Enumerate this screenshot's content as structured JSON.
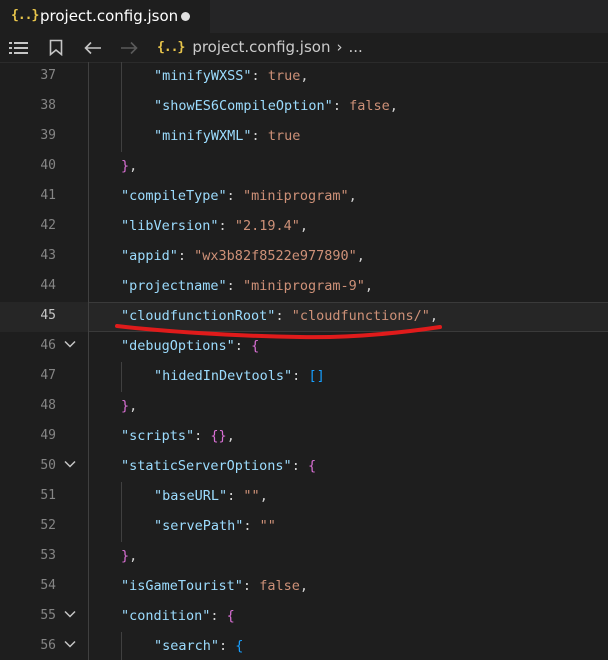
{
  "tab": {
    "title": "project.config.json",
    "icon": "{..}"
  },
  "breadcrumb": {
    "icon": "{..}",
    "file": "project.config.json",
    "more": "..."
  },
  "colors": {
    "annotation": "#e01b1b",
    "background": "#1e1e1e"
  },
  "lines": [
    {
      "num": "37",
      "indent": 2,
      "fold": false,
      "current": false,
      "tokens": [
        {
          "t": "\"minifyWXSS\"",
          "c": "k"
        },
        {
          "t": ": ",
          "c": "p"
        },
        {
          "t": "true",
          "c": "s"
        },
        {
          "t": ",",
          "c": "p"
        }
      ]
    },
    {
      "num": "38",
      "indent": 2,
      "fold": false,
      "current": false,
      "tokens": [
        {
          "t": "\"showES6CompileOption\"",
          "c": "k"
        },
        {
          "t": ": ",
          "c": "p"
        },
        {
          "t": "false",
          "c": "s"
        },
        {
          "t": ",",
          "c": "p"
        }
      ]
    },
    {
      "num": "39",
      "indent": 2,
      "fold": false,
      "current": false,
      "tokens": [
        {
          "t": "\"minifyWXML\"",
          "c": "k"
        },
        {
          "t": ": ",
          "c": "p"
        },
        {
          "t": "true",
          "c": "s"
        }
      ]
    },
    {
      "num": "40",
      "indent": 1,
      "fold": false,
      "current": false,
      "tokens": [
        {
          "t": "}",
          "c": "br2"
        },
        {
          "t": ",",
          "c": "p"
        }
      ]
    },
    {
      "num": "41",
      "indent": 1,
      "fold": false,
      "current": false,
      "tokens": [
        {
          "t": "\"compileType\"",
          "c": "k"
        },
        {
          "t": ": ",
          "c": "p"
        },
        {
          "t": "\"miniprogram\"",
          "c": "s"
        },
        {
          "t": ",",
          "c": "p"
        }
      ]
    },
    {
      "num": "42",
      "indent": 1,
      "fold": false,
      "current": false,
      "tokens": [
        {
          "t": "\"libVersion\"",
          "c": "k"
        },
        {
          "t": ": ",
          "c": "p"
        },
        {
          "t": "\"2.19.4\"",
          "c": "s"
        },
        {
          "t": ",",
          "c": "p"
        }
      ]
    },
    {
      "num": "43",
      "indent": 1,
      "fold": false,
      "current": false,
      "tokens": [
        {
          "t": "\"appid\"",
          "c": "k"
        },
        {
          "t": ": ",
          "c": "p"
        },
        {
          "t": "\"wx3b82f8522e977890\"",
          "c": "s"
        },
        {
          "t": ",",
          "c": "p"
        }
      ]
    },
    {
      "num": "44",
      "indent": 1,
      "fold": false,
      "current": false,
      "tokens": [
        {
          "t": "\"projectname\"",
          "c": "k"
        },
        {
          "t": ": ",
          "c": "p"
        },
        {
          "t": "\"miniprogram-9\"",
          "c": "s"
        },
        {
          "t": ",",
          "c": "p"
        }
      ]
    },
    {
      "num": "45",
      "indent": 1,
      "fold": false,
      "current": true,
      "tokens": [
        {
          "t": "\"cloudfunctionRoot\"",
          "c": "k"
        },
        {
          "t": ": ",
          "c": "p"
        },
        {
          "t": "\"cloudfunctions/\"",
          "c": "s"
        },
        {
          "t": ",",
          "c": "p"
        }
      ]
    },
    {
      "num": "46",
      "indent": 1,
      "fold": true,
      "current": false,
      "tokens": [
        {
          "t": "\"debugOptions\"",
          "c": "k"
        },
        {
          "t": ": ",
          "c": "p"
        },
        {
          "t": "{",
          "c": "br2"
        }
      ]
    },
    {
      "num": "47",
      "indent": 2,
      "fold": false,
      "current": false,
      "tokens": [
        {
          "t": "\"hidedInDevtools\"",
          "c": "k"
        },
        {
          "t": ": ",
          "c": "p"
        },
        {
          "t": "[]",
          "c": "br3"
        }
      ]
    },
    {
      "num": "48",
      "indent": 1,
      "fold": false,
      "current": false,
      "tokens": [
        {
          "t": "}",
          "c": "br2"
        },
        {
          "t": ",",
          "c": "p"
        }
      ]
    },
    {
      "num": "49",
      "indent": 1,
      "fold": false,
      "current": false,
      "tokens": [
        {
          "t": "\"scripts\"",
          "c": "k"
        },
        {
          "t": ": ",
          "c": "p"
        },
        {
          "t": "{}",
          "c": "br2"
        },
        {
          "t": ",",
          "c": "p"
        }
      ]
    },
    {
      "num": "50",
      "indent": 1,
      "fold": true,
      "current": false,
      "tokens": [
        {
          "t": "\"staticServerOptions\"",
          "c": "k"
        },
        {
          "t": ": ",
          "c": "p"
        },
        {
          "t": "{",
          "c": "br2"
        }
      ]
    },
    {
      "num": "51",
      "indent": 2,
      "fold": false,
      "current": false,
      "tokens": [
        {
          "t": "\"baseURL\"",
          "c": "k"
        },
        {
          "t": ": ",
          "c": "p"
        },
        {
          "t": "\"\"",
          "c": "s"
        },
        {
          "t": ",",
          "c": "p"
        }
      ]
    },
    {
      "num": "52",
      "indent": 2,
      "fold": false,
      "current": false,
      "tokens": [
        {
          "t": "\"servePath\"",
          "c": "k"
        },
        {
          "t": ": ",
          "c": "p"
        },
        {
          "t": "\"\"",
          "c": "s"
        }
      ]
    },
    {
      "num": "53",
      "indent": 1,
      "fold": false,
      "current": false,
      "tokens": [
        {
          "t": "}",
          "c": "br2"
        },
        {
          "t": ",",
          "c": "p"
        }
      ]
    },
    {
      "num": "54",
      "indent": 1,
      "fold": false,
      "current": false,
      "tokens": [
        {
          "t": "\"isGameTourist\"",
          "c": "k"
        },
        {
          "t": ": ",
          "c": "p"
        },
        {
          "t": "false",
          "c": "s"
        },
        {
          "t": ",",
          "c": "p"
        }
      ]
    },
    {
      "num": "55",
      "indent": 1,
      "fold": true,
      "current": false,
      "tokens": [
        {
          "t": "\"condition\"",
          "c": "k"
        },
        {
          "t": ": ",
          "c": "p"
        },
        {
          "t": "{",
          "c": "br2"
        }
      ]
    },
    {
      "num": "56",
      "indent": 2,
      "fold": true,
      "current": false,
      "tokens": [
        {
          "t": "\"search\"",
          "c": "k"
        },
        {
          "t": ": ",
          "c": "p"
        },
        {
          "t": "{",
          "c": "br3"
        }
      ]
    }
  ]
}
